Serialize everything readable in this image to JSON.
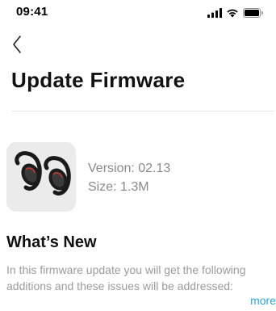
{
  "status_bar": {
    "time": "09:41",
    "icons": [
      "cellular-signal-icon",
      "wifi-icon",
      "battery-icon"
    ]
  },
  "nav": {
    "back_icon": "chevron-left-icon"
  },
  "header": {
    "title": "Update Firmware"
  },
  "product": {
    "image": "earbuds-image",
    "version": "Version: 02.13",
    "size": "Size: 1.3M"
  },
  "whats_new": {
    "title": "What’s New",
    "description": "In this firmware update you will get the following additions and these issues will be addressed:",
    "more_label": "more"
  },
  "colors": {
    "link": "#2aa6e0",
    "muted_text": "#8a8a8a",
    "thumb_bg": "#ebebeb"
  }
}
